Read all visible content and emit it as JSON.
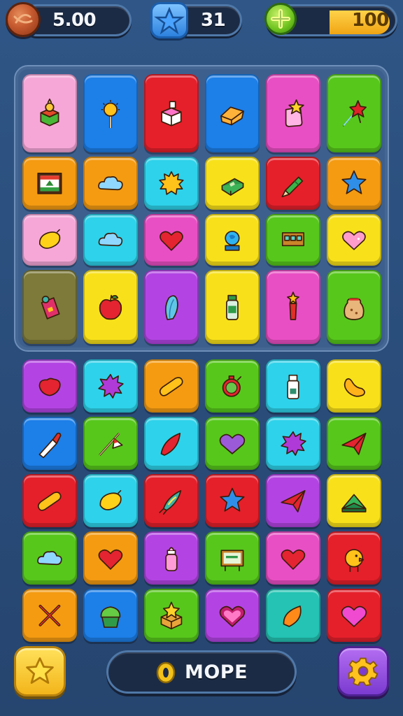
{
  "hud": {
    "coins": "5.00",
    "stars": "31",
    "gems": "100"
  },
  "colors": {
    "pink": "#f6a7d8",
    "blue": "#1d7fe8",
    "red": "#e5202b",
    "magenta": "#e94fc4",
    "green": "#57c71c",
    "orange": "#f49b12",
    "cyan": "#2ed2ea",
    "yellow": "#f8e11a",
    "purple": "#b344e3",
    "olive": "#7d7a3a",
    "teal": "#24c3b3"
  },
  "top_board": {
    "rows": [
      [
        {
          "color": "pink",
          "icon": "cake-box-icon"
        },
        {
          "color": "blue",
          "icon": "lollipop-icon"
        },
        {
          "color": "red",
          "icon": "gift-box-icon"
        },
        {
          "color": "blue",
          "icon": "cheese-block-icon"
        },
        {
          "color": "magenta",
          "icon": "star-jar-icon"
        },
        {
          "color": "green",
          "icon": "star-wand-icon"
        }
      ],
      [
        {
          "color": "orange",
          "icon": "framed-picture-icon"
        },
        {
          "color": "orange",
          "icon": "cloud-icon"
        },
        {
          "color": "cyan",
          "icon": "sun-gear-icon"
        },
        {
          "color": "yellow",
          "icon": "green-book-icon"
        },
        {
          "color": "red",
          "icon": "crayon-icon"
        },
        {
          "color": "orange",
          "icon": "star-icon"
        }
      ],
      [
        {
          "color": "pink",
          "icon": "lemon-icon"
        },
        {
          "color": "cyan",
          "icon": "cloud-icon"
        },
        {
          "color": "magenta",
          "icon": "heart-icon"
        },
        {
          "color": "yellow",
          "icon": "globe-trophy-icon"
        },
        {
          "color": "green",
          "icon": "control-panel-icon"
        },
        {
          "color": "yellow",
          "icon": "pink-heart-icon"
        }
      ],
      [
        {
          "color": "olive",
          "icon": "tag-icon"
        },
        {
          "color": "yellow",
          "icon": "apple-icon"
        },
        {
          "color": "purple",
          "icon": "feather-icon"
        },
        {
          "color": "yellow",
          "icon": "bottle-icon"
        },
        {
          "color": "magenta",
          "icon": "paint-tube-icon"
        },
        {
          "color": "green",
          "icon": "sack-icon"
        }
      ]
    ]
  },
  "bottom_board": {
    "rows": [
      [
        {
          "color": "purple",
          "icon": "red-gem-icon"
        },
        {
          "color": "cyan",
          "icon": "splat-icon"
        },
        {
          "color": "orange",
          "icon": "capsule-icon"
        },
        {
          "color": "green",
          "icon": "stopwatch-icon"
        },
        {
          "color": "cyan",
          "icon": "milk-bottle-icon"
        },
        {
          "color": "yellow",
          "icon": "bean-icon"
        }
      ],
      [
        {
          "color": "blue",
          "icon": "paintbrush-icon"
        },
        {
          "color": "green",
          "icon": "flag-icon"
        },
        {
          "color": "cyan",
          "icon": "red-leaf-icon"
        },
        {
          "color": "green",
          "icon": "purple-heart-icon"
        },
        {
          "color": "cyan",
          "icon": "splat-icon"
        },
        {
          "color": "green",
          "icon": "paper-plane-icon"
        }
      ],
      [
        {
          "color": "red",
          "icon": "capsule-icon"
        },
        {
          "color": "cyan",
          "icon": "lemon-icon"
        },
        {
          "color": "red",
          "icon": "rocket-icon"
        },
        {
          "color": "red",
          "icon": "star-icon"
        },
        {
          "color": "purple",
          "icon": "paper-plane-icon"
        },
        {
          "color": "yellow",
          "icon": "tent-icon"
        }
      ],
      [
        {
          "color": "green",
          "icon": "cloud-icon"
        },
        {
          "color": "orange",
          "icon": "heart-icon"
        },
        {
          "color": "purple",
          "icon": "baby-bottle-icon"
        },
        {
          "color": "green",
          "icon": "sign-board-icon"
        },
        {
          "color": "magenta",
          "icon": "heart-icon"
        },
        {
          "color": "red",
          "icon": "chick-icon"
        }
      ],
      [
        {
          "color": "orange",
          "icon": "scissors-icon"
        },
        {
          "color": "blue",
          "icon": "cupcake-icon"
        },
        {
          "color": "green",
          "icon": "star-box-icon"
        },
        {
          "color": "purple",
          "icon": "heart-frame-icon"
        },
        {
          "color": "teal",
          "icon": "orange-leaf-icon"
        },
        {
          "color": "red",
          "icon": "magenta-heart-icon"
        }
      ]
    ]
  },
  "footer": {
    "more_label": "MOPE"
  }
}
